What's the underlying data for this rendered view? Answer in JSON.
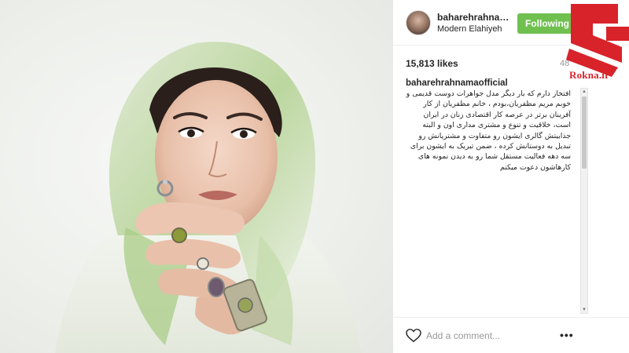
{
  "post": {
    "username": "baharehrahnam...",
    "location": "Modern Elahiyeh",
    "follow_label": "Following",
    "likes": "15,813 likes",
    "time": "48",
    "caption_user": "baharehrahnamaofficial",
    "caption_text": "افتخار دارم که بار دیگر مدل جواهرات دوست قدیمی و خوبم مریم مظفریان،بودم ، خانم مظفریان از کار آفرینان برتر در عرصه کار اقتصادی زنان در ایران است، خلاقیت و تنوع و مشتری مداری اون و البته جذابیتش گالری ایشون رو متفاوت و مشتریانش رو تبدیل به دوستانش کرده ، ضمن تبریک به ایشون برای سه دهه فعالیت مستقل شما رو به دیدن نمونه های کارهاشون دعوت میکنم",
    "comment_placeholder": "Add a comment...",
    "more_label": "•••"
  },
  "watermark": {
    "text": "Rokna.ir",
    "color": "#d8232a"
  },
  "colors": {
    "follow_button": "#70c050",
    "text": "#262626",
    "muted": "#999999"
  },
  "icons": {
    "like": "heart-icon",
    "options": "more-options-icon"
  }
}
